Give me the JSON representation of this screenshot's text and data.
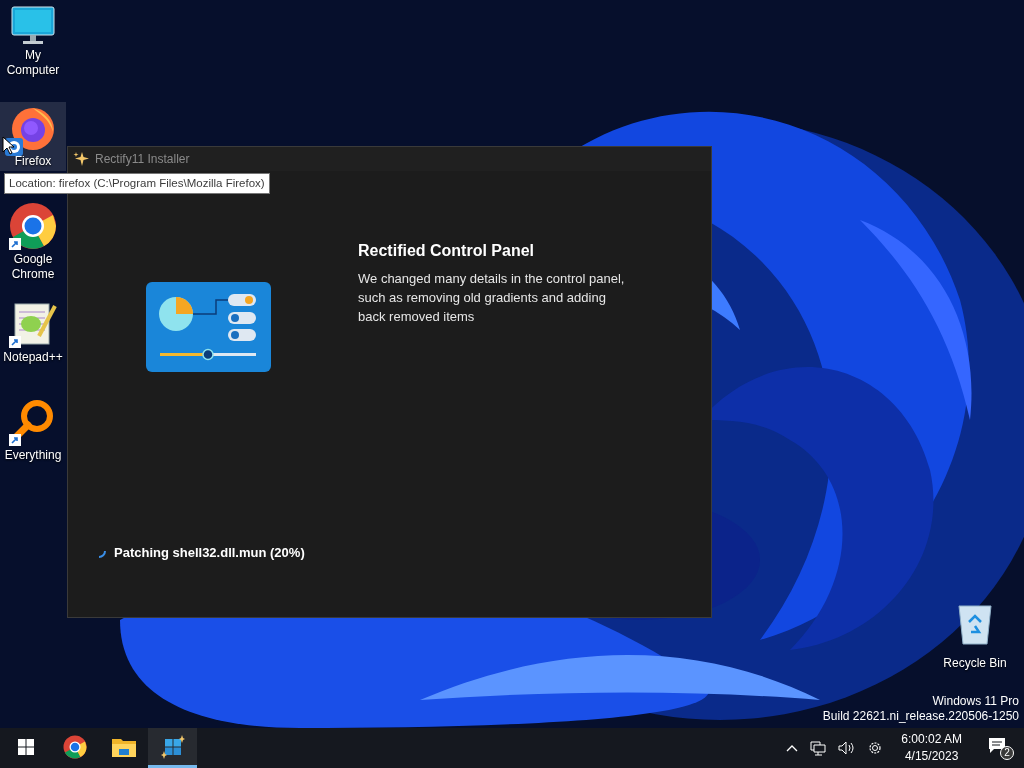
{
  "desktop_icons": [
    {
      "label": "My Computer",
      "kind": "computer",
      "selected": false
    },
    {
      "label": "Firefox",
      "kind": "firefox",
      "selected": true
    },
    {
      "label": "Google Chrome",
      "kind": "chrome",
      "selected": false
    },
    {
      "label": "Notepad++",
      "kind": "notepad",
      "selected": false
    },
    {
      "label": "Everything",
      "kind": "everything",
      "selected": false
    }
  ],
  "recycle_bin": {
    "label": "Recycle Bin"
  },
  "tooltip": "Location: firefox (C:\\Program Files\\Mozilla Firefox)",
  "window": {
    "title": "Rectify11 Installer",
    "heading": "Rectified Control Panel",
    "description": "We changed many details in the control panel, such as removing old gradients and adding back removed items",
    "status": "Patching shell32.dll.mun (20%)"
  },
  "watermark": {
    "edition": "Windows 11 Pro",
    "build": "Build 22621.ni_release.220506-1250"
  },
  "taskbar": {
    "items": [
      {
        "kind": "start",
        "selected": false
      },
      {
        "kind": "chrome",
        "selected": false
      },
      {
        "kind": "explorer",
        "selected": false
      },
      {
        "kind": "rectify",
        "selected": true
      }
    ],
    "time": "6:00:02 AM",
    "date": "4/15/2023",
    "notifications": "2"
  }
}
